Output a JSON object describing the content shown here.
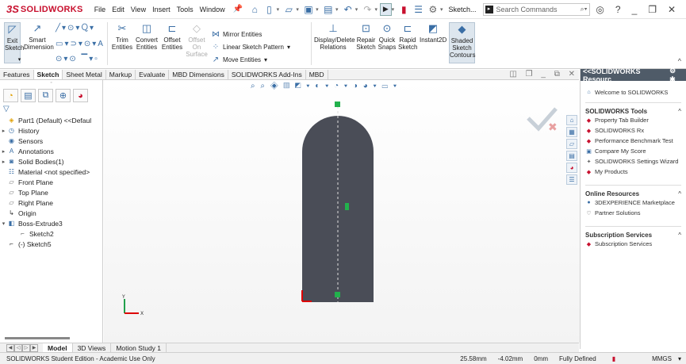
{
  "app": {
    "logo_ds": "3S",
    "logo_name": "SOLIDWORKS"
  },
  "menu": [
    "File",
    "Edit",
    "View",
    "Insert",
    "Tools",
    "Window"
  ],
  "titlebar": {
    "sketch_dropdown": "Sketch...",
    "search_placeholder": "Search Commands"
  },
  "ribbon": {
    "exit_sketch": "Exit Sketch",
    "smart_dimension": "Smart Dimension",
    "trim_entities": "Trim Entities",
    "convert_entities": "Convert Entities",
    "offset_entities": "Offset Entities",
    "offset_on_surface": "Offset On Surface",
    "mirror_entities": "Mirror Entities",
    "linear_sketch_pattern": "Linear Sketch Pattern",
    "move_entities": "Move Entities",
    "display_delete_relations": "Display/Delete Relations",
    "repair_sketch": "Repair Sketch",
    "quick_snaps": "Quick Snaps",
    "rapid_sketch": "Rapid Sketch",
    "instant2d": "Instant2D",
    "shaded_sketch_contours": "Shaded Sketch Contours"
  },
  "tabs": [
    "Features",
    "Sketch",
    "Sheet Metal",
    "Markup",
    "Evaluate",
    "MBD Dimensions",
    "SOLIDWORKS Add-Ins",
    "MBD"
  ],
  "active_tab": "Sketch",
  "tree": [
    {
      "label": "Part1 (Default) <<Defaul",
      "icon": "part-icon",
      "expand": ""
    },
    {
      "label": "History",
      "icon": "history-icon",
      "expand": "▸"
    },
    {
      "label": "Sensors",
      "icon": "sensors-icon",
      "expand": ""
    },
    {
      "label": "Annotations",
      "icon": "annotations-icon",
      "expand": "▸"
    },
    {
      "label": "Solid Bodies(1)",
      "icon": "solid-bodies-icon",
      "expand": "▸"
    },
    {
      "label": "Material <not specified>",
      "icon": "material-icon",
      "expand": ""
    },
    {
      "label": "Front Plane",
      "icon": "plane-icon",
      "expand": ""
    },
    {
      "label": "Top Plane",
      "icon": "plane-icon",
      "expand": ""
    },
    {
      "label": "Right Plane",
      "icon": "plane-icon",
      "expand": ""
    },
    {
      "label": "Origin",
      "icon": "origin-icon",
      "expand": ""
    },
    {
      "label": "Boss-Extrude3",
      "icon": "boss-extrude-icon",
      "expand": "▾"
    },
    {
      "label": "Sketch2",
      "icon": "sketch-icon",
      "expand": "",
      "indent": true
    },
    {
      "label": "(-) Sketch5",
      "icon": "sketch-icon",
      "expand": ""
    }
  ],
  "resources": {
    "header": "<<SOLIDWORKS Resourc",
    "welcome": "Welcome to SOLIDWORKS",
    "tools_title": "SOLIDWORKS Tools",
    "tools": [
      "Property Tab Builder",
      "SOLIDWORKS Rx",
      "Performance Benchmark Test",
      "Compare My Score",
      "SOLIDWORKS Settings Wizard",
      "My Products"
    ],
    "online_title": "Online Resources",
    "online": [
      "3DEXPERIENCE Marketplace",
      "Partner Solutions"
    ],
    "subs_title": "Subscription Services",
    "subs": [
      "Subscription Services"
    ]
  },
  "bottom_tabs": [
    "Model",
    "3D Views",
    "Motion Study 1"
  ],
  "active_bottom_tab": "Model",
  "status": {
    "edition": "SOLIDWORKS Student Edition - Academic Use Only",
    "x": "25.58mm",
    "y": "-4.02mm",
    "z": "0mm",
    "state": "Fully Defined",
    "units": "MMGS"
  },
  "colors": {
    "brand": "#c8102e",
    "accent": "#3a6ea5",
    "sketch_fill": "#4a4d57",
    "sketch_point": "#22b14c"
  }
}
